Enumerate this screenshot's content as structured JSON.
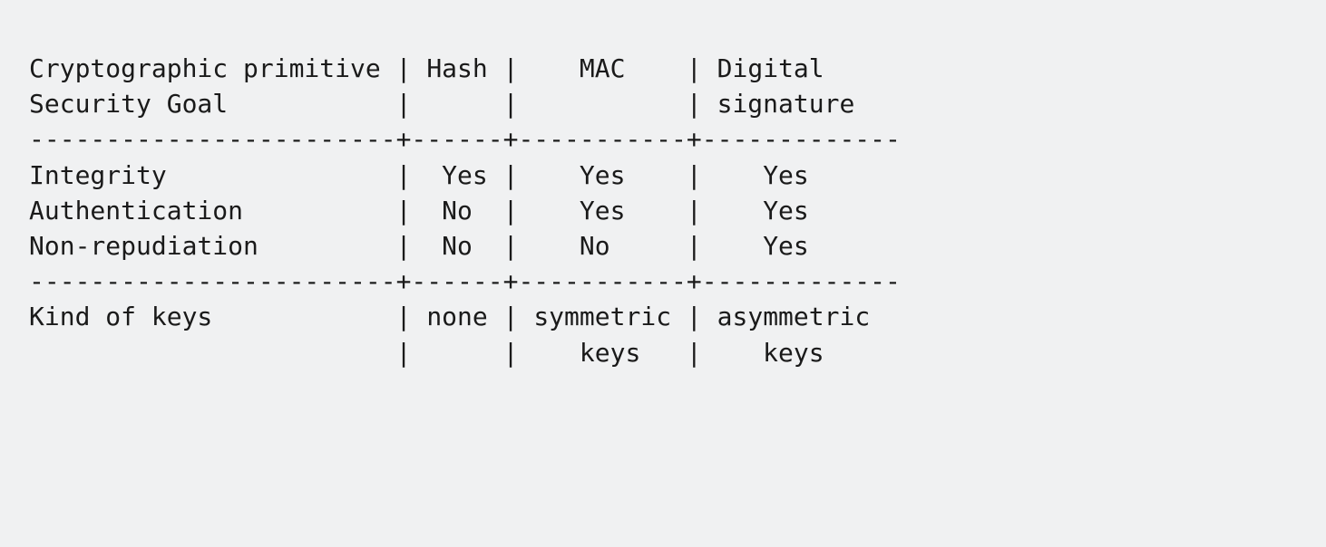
{
  "chart_data": {
    "type": "table",
    "title": "",
    "header_rows": [
      {
        "label_top": "Cryptographic primitive",
        "label_bottom": "Security Goal",
        "cols": [
          "Hash",
          "MAC",
          "Digital signature"
        ]
      }
    ],
    "body_rows": [
      {
        "label": "Integrity",
        "values": [
          "Yes",
          "Yes",
          "Yes"
        ]
      },
      {
        "label": "Authentication",
        "values": [
          "No",
          "Yes",
          "Yes"
        ]
      },
      {
        "label": "Non-repudiation",
        "values": [
          "No",
          "No",
          "Yes"
        ]
      }
    ],
    "footer_rows": [
      {
        "label": "Kind of keys",
        "values": [
          "none",
          "symmetric keys",
          "asymmetric keys"
        ]
      }
    ]
  },
  "table": {
    "r1": {
      "c0a": "Cryptographic primitive",
      "c1a": "Hash",
      "c2a": "MAC",
      "c3a": "Digital"
    },
    "r2": {
      "c0a": "Security Goal",
      "c1a": "",
      "c2a": "",
      "c3a": "signature"
    },
    "sep1": "------------------------+------+-----------+-------------",
    "r3": {
      "c0": "Integrity",
      "c1": "Yes",
      "c2": "Yes",
      "c3": "Yes"
    },
    "r4": {
      "c0": "Authentication",
      "c1": "No",
      "c2": "Yes",
      "c3": "Yes"
    },
    "r5": {
      "c0": "Non-repudiation",
      "c1": "No",
      "c2": "No",
      "c3": "Yes"
    },
    "sep2": "------------------------+------+-----------+-------------",
    "r6": {
      "c0": "Kind of keys",
      "c1": "none",
      "c2": "symmetric",
      "c3": "asymmetric"
    },
    "r7": {
      "c0": "",
      "c1": "",
      "c2": "keys",
      "c3": "keys"
    }
  }
}
